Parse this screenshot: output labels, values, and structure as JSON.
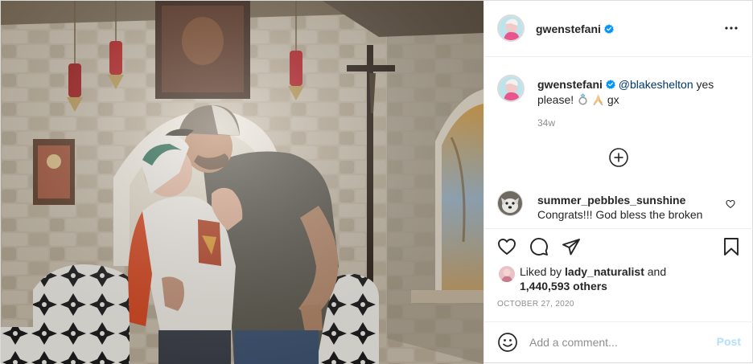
{
  "post": {
    "author": "gwenstefani",
    "author_verified": true,
    "photo_alt": "photo by gwenstefani"
  },
  "header": {
    "username": "gwenstefani",
    "more_icon": "more-horizontal-icon"
  },
  "caption": {
    "username": "gwenstefani",
    "mention": "@blakeshelton",
    "text_after_mention": " yes please! ",
    "emojis": [
      "ring-emoji",
      "praying-hands-emoji"
    ],
    "signature": " gx",
    "time_ago": "34w"
  },
  "load_more_icon": "plus-circle-icon",
  "comments": [
    {
      "username": "summer_pebbles_sunshine",
      "text": "Congrats!!! God bless the broken",
      "like_icon": "heart-outline-icon"
    }
  ],
  "actions": {
    "like_icon": "heart-outline-icon",
    "comment_icon": "speech-bubble-icon",
    "share_icon": "paper-plane-icon",
    "save_icon": "bookmark-icon"
  },
  "likes": {
    "prefix": "Liked by ",
    "user": "lady_naturalist",
    "conjunction": " and",
    "count": "1,440,593 others"
  },
  "date": "OCTOBER 27, 2020",
  "add_comment": {
    "placeholder": "Add a comment...",
    "post_label": "Post",
    "emoji_icon": "smiley-icon"
  },
  "colors": {
    "link": "#00376b",
    "verified": "#0095f6",
    "post_disabled": "#b2dffc",
    "secondary_text": "#8e8e8e"
  }
}
